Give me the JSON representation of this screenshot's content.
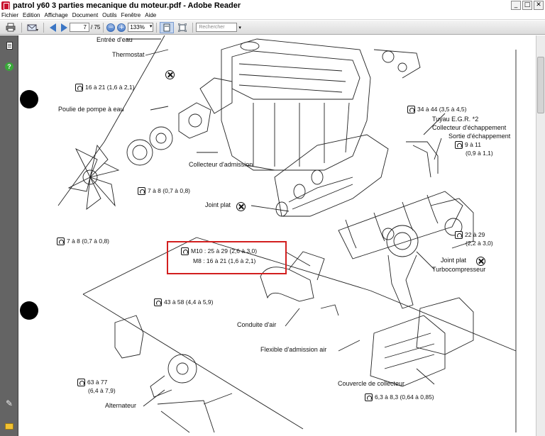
{
  "window": {
    "title": "patrol y60 3 parties mecanique du moteur.pdf - Adobe Reader",
    "minimize_glyph": "_",
    "maximize_glyph": "□",
    "close_glyph": "✕"
  },
  "menu": {
    "items": [
      "Fichier",
      "Edition",
      "Affichage",
      "Document",
      "Outils",
      "Fenêtre",
      "Aide"
    ]
  },
  "toolbar": {
    "current_page": "7",
    "total_pages": "/ 75",
    "zoom": "133%",
    "search_placeholder": "Rechercher",
    "icons": [
      "print-icon",
      "email-icon",
      "previous-page-icon",
      "next-page-icon",
      "zoom-out-icon",
      "zoom-in-icon",
      "single-page-icon",
      "fit-page-icon"
    ]
  },
  "leftpane": {
    "icons": [
      "pages-icon",
      "help-icon",
      "attachment-icon",
      "comments-icon"
    ]
  },
  "drawing": {
    "labels": {
      "entree_eau": "Entrée d'eau",
      "thermostat": "Thermostat",
      "poulie": "Poulie de pompe à eau",
      "collecteur_admission": "Collecteur d'admission",
      "joint_plat_1": "Joint plat",
      "tuyau_egr": "Tuyau E.G.R. *2",
      "collecteur_echappement": "Collecteur d'échappement",
      "sortie_echappement": "Sortie d'échappement",
      "joint_plat_2": "Joint plat",
      "turbocompresseur": "Turbocompresseur",
      "conduite_air": "Conduite d'air",
      "flexible": "Flexible d'admission air",
      "couvercle": "Couvercle de collecteur",
      "alternateur": "Alternateur"
    },
    "torques": {
      "t1": "16 à 21 (1,6 à 2,1)",
      "t2": "7 à 8 (0,7 à 0,8)",
      "t3": "7 à 8 (0,7 à 0,8)",
      "t4": "34 à 44 (3,5 à 4,5)",
      "t5a": "9 à 11",
      "t5b": "(0,9 à 1,1)",
      "t6a": "22 à 29",
      "t6b": "(2,2 à 3,0)",
      "m10_label": "M10",
      "m10_value": ": 25 à 29 (2,6 à 3,0)",
      "m8_label": "M8",
      "m8_value": ": 16 à 21 (1,6 à 2,1)",
      "t7": "43 à 58 (4,4 à 5,9)",
      "t8a": "63 à 77",
      "t8b": "(6,4 à 7,9)",
      "t9": "6,3 à 8,3 (0,64 à 0,85)"
    }
  }
}
